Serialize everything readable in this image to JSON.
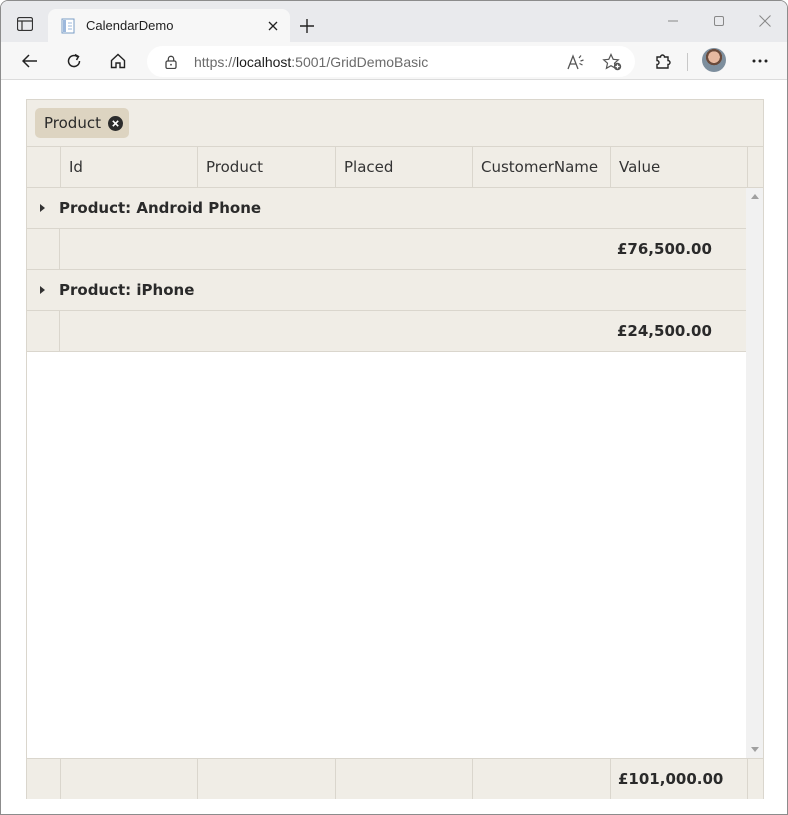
{
  "browser": {
    "tab": {
      "title": "CalendarDemo"
    },
    "address": {
      "scheme": "https://",
      "host": "localhost",
      "rest": ":5001/GridDemoBasic"
    }
  },
  "grid": {
    "group_chip": {
      "label": "Product"
    },
    "columns": [
      "Id",
      "Product",
      "Placed",
      "CustomerName",
      "Value"
    ],
    "groups": [
      {
        "title": "Product: Android Phone",
        "sum": "£76,500.00"
      },
      {
        "title": "Product: iPhone",
        "sum": "£24,500.00"
      }
    ],
    "total": "£101,000.00"
  },
  "colors": {
    "grid_header_bg": "#f0ede6",
    "chip_bg": "#ddd4c1",
    "border": "#dad6cd"
  }
}
